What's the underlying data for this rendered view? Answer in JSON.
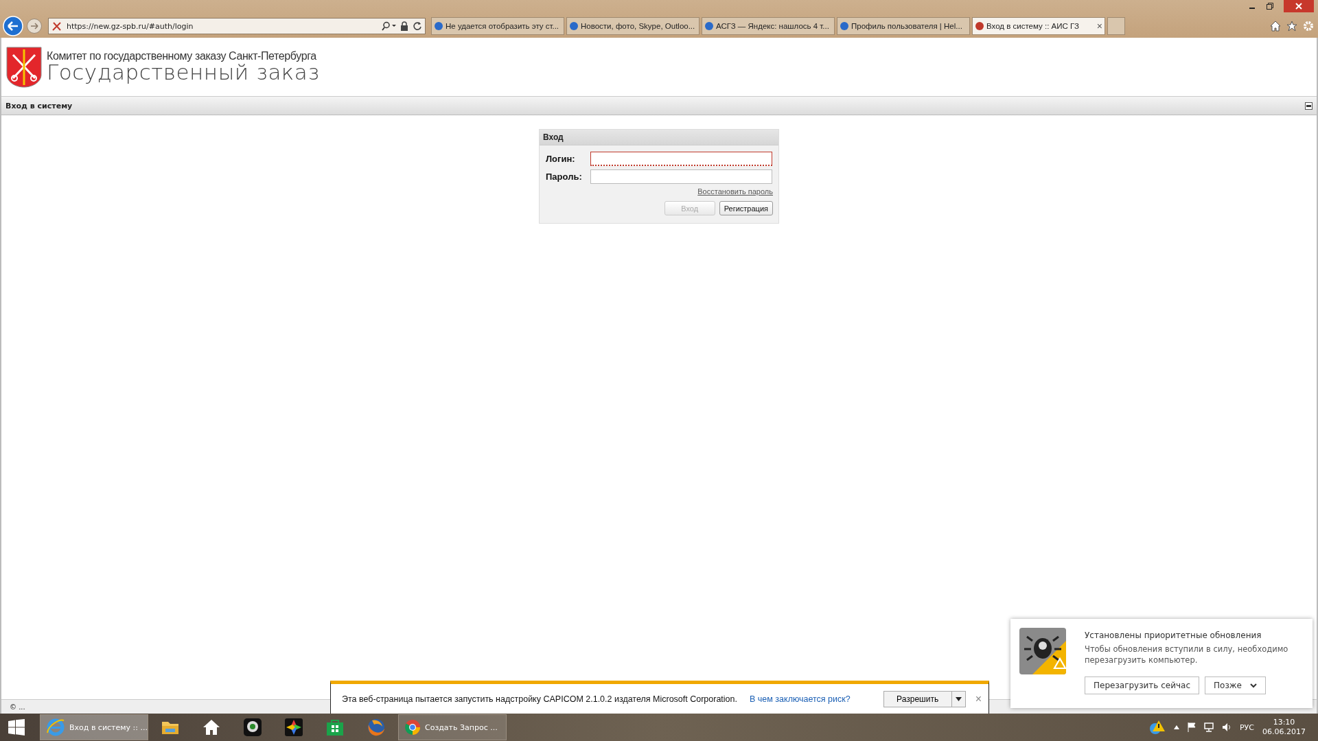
{
  "browser": {
    "address": "https://new.gz-spb.ru/#auth/login",
    "tabs": [
      {
        "title": "Не удается отобразить эту ст...",
        "selected": false
      },
      {
        "title": "Новости, фото, Skype, Outloo...",
        "selected": false
      },
      {
        "title": "АСГЗ — Яндекс: нашлось 4 т...",
        "selected": false
      },
      {
        "title": "Профиль пользователя | Hel...",
        "selected": false
      },
      {
        "title": "Вход в систему :: АИС ГЗ",
        "selected": true,
        "close": "×"
      }
    ]
  },
  "header": {
    "subtitle": "Комитет по государственному заказу Санкт-Петербурга",
    "title": "Государственный заказ"
  },
  "page_bar": {
    "title": "Вход в систему"
  },
  "login": {
    "title": "Вход",
    "fields": [
      {
        "label": "Логин:",
        "invalid": true
      },
      {
        "label": "Пароль:",
        "invalid": false
      }
    ],
    "recover_link": "Восстановить пароль",
    "buttons": [
      {
        "label": "Вход",
        "disabled": true
      },
      {
        "label": "Регистрация",
        "disabled": false
      }
    ]
  },
  "status_bar": {
    "text": "© ..."
  },
  "infobar": {
    "message": "Эта веб-страница пытается запустить надстройку CAPICOM 2.1.0.2 издателя Microsoft Corporation.",
    "link": "В чем заключается риск?",
    "button": "Разрешить",
    "close": "×"
  },
  "toast": {
    "title": "Установлены приоритетные обновления",
    "body": "Чтобы обновления вступили в силу, необходимо перезагрузить компьютер.",
    "buttons": [
      "Перезагрузить сейчас",
      "Позже"
    ]
  },
  "taskbar": {
    "items": [
      {
        "kind": "ie",
        "label": "Вход в систему :: ...",
        "selected": true
      },
      {
        "kind": "folder",
        "selected": false
      },
      {
        "kind": "home",
        "selected": false
      },
      {
        "kind": "camera",
        "selected": false
      },
      {
        "kind": "paint",
        "selected": false
      },
      {
        "kind": "store",
        "selected": false
      },
      {
        "kind": "firefox",
        "selected": false
      },
      {
        "kind": "chrome",
        "label": "Создать Запрос ...",
        "selected": false
      }
    ],
    "language": "РУС",
    "time": "13:10",
    "date": "06.06.2017"
  }
}
